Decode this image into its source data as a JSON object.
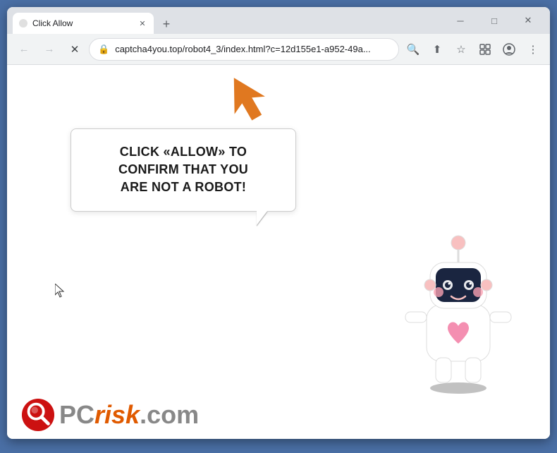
{
  "window": {
    "title": "Click Allow",
    "tab_title": "Click Allow"
  },
  "titlebar": {
    "minimize": "─",
    "maximize": "□",
    "close": "✕",
    "new_tab": "+"
  },
  "navbar": {
    "back": "←",
    "forward": "→",
    "reload": "✕",
    "url": "captcha4you.top/robot4_3/index.html?c=12d155e1-a952-49a...",
    "search_icon": "🔍",
    "share_icon": "⬆",
    "bookmark_icon": "☆",
    "extensions_icon": "□",
    "profile_icon": "○",
    "menu_icon": "⋮"
  },
  "page": {
    "bubble_text_line1": "CLICK «ALLOW» TO CONFIRM THAT YOU",
    "bubble_text_line2": "ARE NOT A ROBOT!"
  },
  "logo": {
    "text_pc": "PC",
    "text_risk": "risk",
    "text_domain": ".com"
  }
}
